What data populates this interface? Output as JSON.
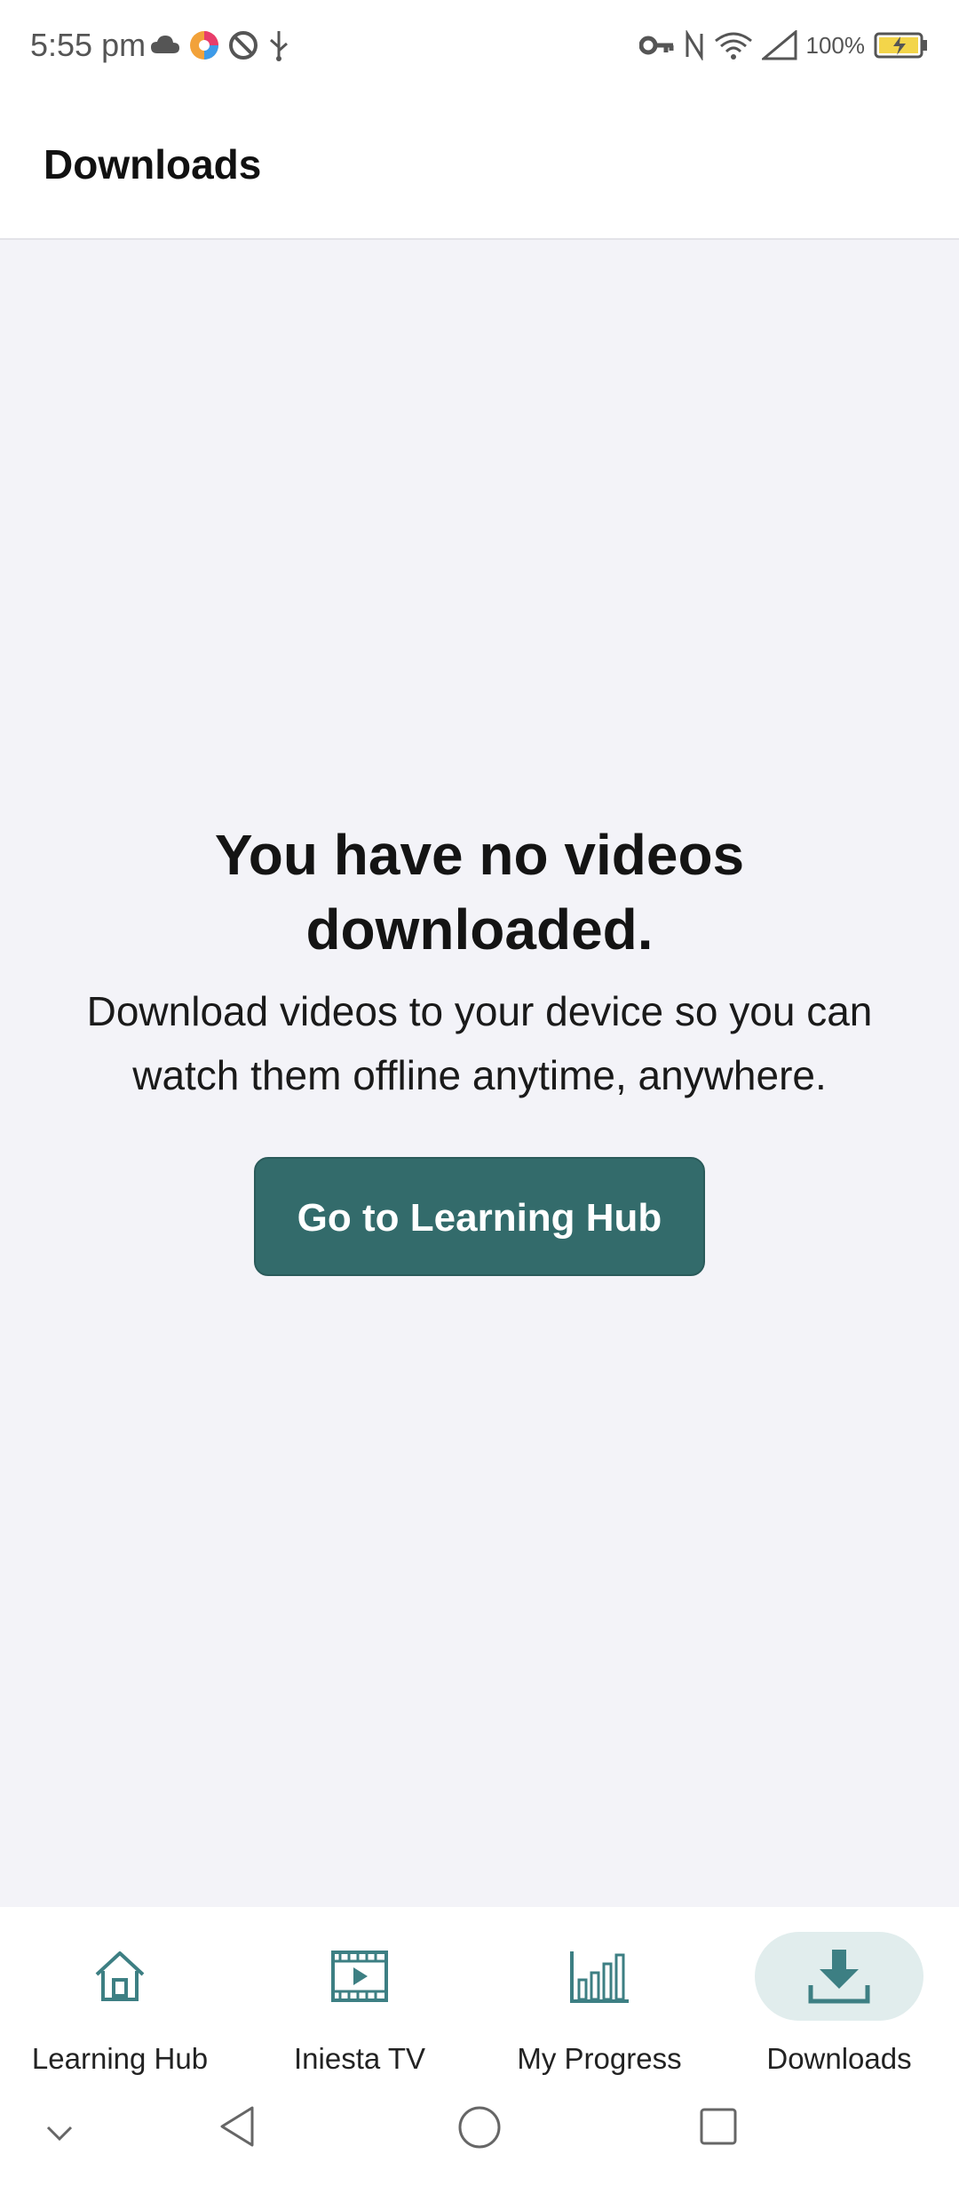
{
  "status_bar": {
    "time": "5:55 pm",
    "battery": "100%",
    "left_icons": [
      "cloud-icon",
      "app-icon",
      "at-icon",
      "usb-icon"
    ],
    "right_icons": [
      "key-icon",
      "nfc-icon",
      "wifi-icon",
      "signal-icon",
      "battery-charging-icon"
    ]
  },
  "header": {
    "title": "Downloads"
  },
  "empty_state": {
    "title": "You have no videos downloaded.",
    "description": "Download videos to your device so you can watch them offline anytime, anywhere.",
    "button_label": "Go to Learning Hub"
  },
  "bottom_nav": {
    "items": [
      {
        "label": "Learning Hub",
        "icon": "home-icon",
        "active": false
      },
      {
        "label": "Iniesta TV",
        "icon": "video-icon",
        "active": false
      },
      {
        "label": "My Progress",
        "icon": "bar-chart-icon",
        "active": false
      },
      {
        "label": "Downloads",
        "icon": "download-icon",
        "active": true
      }
    ]
  },
  "colors": {
    "accent": "#336b6b",
    "icon": "#3d7f83",
    "active_pill": "#e1eded",
    "background": "#f3f3f8"
  }
}
